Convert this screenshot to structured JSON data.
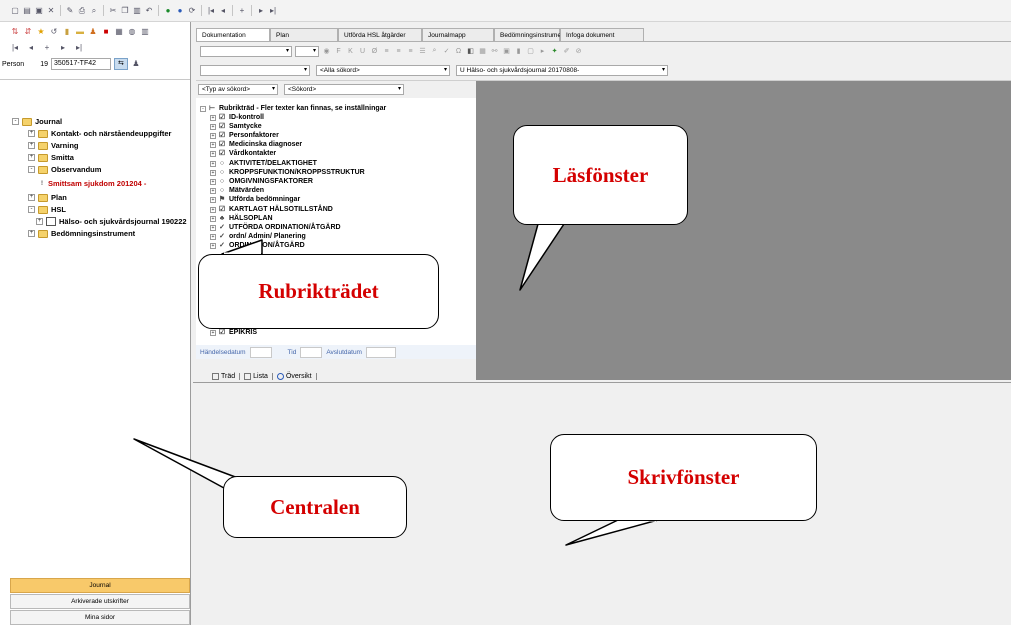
{
  "left_panel": {
    "person_label": "Person",
    "person_id_prefix": "19",
    "person_id_value": "350517-TF42",
    "tree": [
      {
        "label": "Journal",
        "level": 0,
        "expand": "-",
        "folder": true,
        "red": false
      },
      {
        "label": "Kontakt- och närståendeuppgifter",
        "level": 1,
        "expand": "+",
        "folder": true,
        "red": false
      },
      {
        "label": "Varning",
        "level": 1,
        "expand": "+",
        "folder": true,
        "red": false
      },
      {
        "label": "Smitta",
        "level": 1,
        "expand": "+",
        "folder": true,
        "red": false
      },
      {
        "label": "Observandum",
        "level": 1,
        "expand": "-",
        "folder": true,
        "red": false
      },
      {
        "label": "Smittsam sjukdom 201204 -",
        "level": 2,
        "expand": "",
        "folder": false,
        "red": true
      },
      {
        "label": "Plan",
        "level": 1,
        "expand": "+",
        "folder": true,
        "red": false
      },
      {
        "label": "HSL",
        "level": 1,
        "expand": "-",
        "folder": true,
        "red": false
      },
      {
        "label": "Hälso- och sjukvårdsjournal 190222",
        "level": 2,
        "expand": "+",
        "folder": false,
        "red": false
      },
      {
        "label": "Bedömningsinstrument",
        "level": 1,
        "expand": "+",
        "folder": true,
        "red": false
      }
    ],
    "bottom_tabs": [
      "Journal",
      "Arkiverade utskrifter",
      "Mina sidor"
    ]
  },
  "tabs": [
    "Dokumentation",
    "Plan",
    "Utförda HSL åtgärder",
    "Journalmapp",
    "Bedömningsinstrument",
    "Infoga dokument"
  ],
  "search": {
    "all_keywords": "<Alla sökord>",
    "journal_select": "U Hälso- och sjukvårdsjournal 20170808-"
  },
  "filters": {
    "type_keyword": "<Typ av sökord>",
    "keyword": "<Sökord>"
  },
  "rubrik_tree": [
    {
      "label": "Rubrikträd - Fler texter kan finnas, se inställningar",
      "icon": "tree-icon"
    },
    {
      "label": "ID-kontroll",
      "icon": "doc-icon"
    },
    {
      "label": "Samtycke",
      "icon": "doc-icon"
    },
    {
      "label": "Personfaktorer",
      "icon": "doc-icon"
    },
    {
      "label": "Medicinska diagnoser",
      "icon": "doc-icon"
    },
    {
      "label": "Vårdkontakter",
      "icon": "doc-icon"
    },
    {
      "label": "AKTIVITET/DELAKTIGHET",
      "icon": "circle-icon"
    },
    {
      "label": "KROPPSFUNKTION/KROPPSSTRUKTUR",
      "icon": "circle-icon"
    },
    {
      "label": "OMGIVNINGSFAKTORER",
      "icon": "circle-icon"
    },
    {
      "label": "Mätvärden",
      "icon": "circle-icon"
    },
    {
      "label": "Utförda bedömningar",
      "icon": "flag-icon"
    },
    {
      "label": "KARTLAGT HÄLSOTILLSTÅND",
      "icon": "doc-icon"
    },
    {
      "label": "HÄLSOPLAN",
      "icon": "people-icon"
    },
    {
      "label": "UTFÖRDA ORDINATION/ÅTGÄRD",
      "icon": "check-icon"
    },
    {
      "label": "ordn/ Admin/ Planering",
      "icon": "check-icon"
    },
    {
      "label": "ORDINATION/ÅTGÄRD",
      "icon": "check-icon"
    },
    {
      "label": "EPIKRIS",
      "icon": "doc-icon"
    }
  ],
  "dates": {
    "event_date_label": "Händelsedatum",
    "time_label": "Tid",
    "end_date_label": "Avslutdatum"
  },
  "view_tabs": [
    "Träd",
    "Lista",
    "Översikt"
  ],
  "callouts": {
    "read_window": "Läsfönster",
    "heading_tree": "Rubrikträdet",
    "write_window": "Skrivfönster",
    "central": "Centralen"
  },
  "colors": {
    "viewer_bg": "#8a8a8a",
    "active_tab": "#f8c96a",
    "callout_text": "#d40000"
  }
}
